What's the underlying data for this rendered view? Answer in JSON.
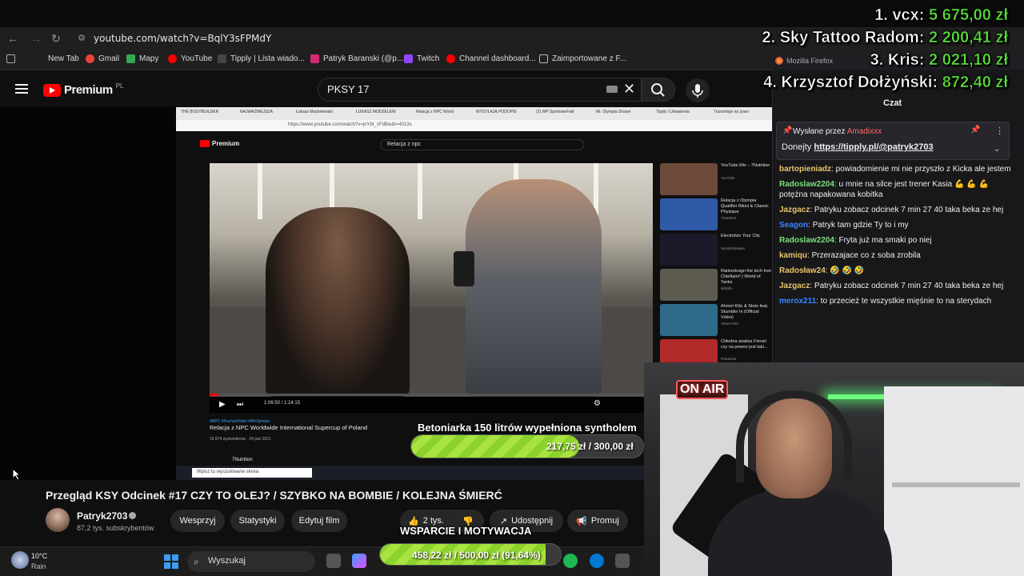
{
  "browser": {
    "url": "youtube.com/watch?v=BqlY3sFPMdY",
    "bookmarks": [
      "New Tab",
      "Gmail",
      "Mapy",
      "YouTube",
      "Tipply | Lista wiado...",
      "Patryk Baranski (@p...",
      "Twitch",
      "Channel dashboard...",
      "Zaimportowane z F..."
    ]
  },
  "youtube": {
    "logo": "Premium",
    "country": "PL",
    "search_query": "PKSY 17",
    "video_title": "Przegląd KSY Odcinek #17 CZY TO OLEJ? / SZYBKO NA BOMBIE / KOLEJNA ŚMIERĆ",
    "channel_name": "Patryk2703",
    "subscribers": "87,2 tys. subskrybentów",
    "actions": {
      "support": "Wesprzyj",
      "stats": "Statystyki",
      "edit": "Edytuj film",
      "likes": "2 tys.",
      "share": "Udostępnij",
      "promote": "Promuj"
    }
  },
  "inner_screen": {
    "tabs": [
      "THE BODYBUILDER",
      "NAJWAŻNIEJSZA",
      "Łukasz Modzelewski",
      "ŁUKASZ MODZELEW",
      "Relacja z NPC World",
      "WYSYŁAJĄ PODOPIE",
      "(2) WP SportoweFakt",
      "Mr. Olympia Shawn",
      "Tipply | Ustawienia",
      "Transmisje na żywo"
    ],
    "url": "https://www.youtube.com/watch?v=jnYbt_sFdBw&t=4013s",
    "logo": "Premium",
    "search_query": "Relacja z npc",
    "video_time": "1:06:50 / 1:24:15",
    "tags": "#NPC #PucharPolski #MrOlympia",
    "video_title": "Relacja z NPC Worldwide International Supercup of Poland",
    "views": "15 874 wyświetlenia",
    "date": "24 paź 2021",
    "channel": "7Nutrition",
    "taskbar_search": "Wpisz tu wyszukiwane słowa",
    "suggestions": [
      {
        "title": "YouTube Mix – 7Nutrition",
        "meta": "YouTube",
        "color": "#6b4a3a"
      },
      {
        "title": "Relacja z Olympia Qualifier Bikini & Classic Physique",
        "meta": "7Nutrition",
        "color": "#2f5aa8"
      },
      {
        "title": "Electrolize Your City",
        "meta": "Symphobreaks",
        "color": "#1a1a2a"
      },
      {
        "title": "Rankedvagn the tech tree Chieftain!! | World of Tanks",
        "meta": "skill4ltu",
        "color": "#5d5a50"
      },
      {
        "title": "Ahmet Kilic & Stoto feat. Stumblin In (Official Video)",
        "meta": "Ahmet Kilic",
        "color": "#2e6a8a"
      },
      {
        "title": "Chłodna analiza Ferrari czy na pewno jest taki...",
        "meta": "Poważnie",
        "color": "#b02a2a"
      }
    ]
  },
  "goals": {
    "goal1_title": "Betoniarka 150 litrów wypełniona syntholem",
    "goal1_amount": "217,75 zł / 300,00 zł",
    "goal1_progress": 0.7258,
    "goal2_title": "WSPARCIE I MOTYWACJA",
    "goal2_amount": "458,22 zł / 500,00 zł (91,64%)",
    "goal2_progress": 0.9164
  },
  "leaderboard": [
    {
      "rank": "1.",
      "name": "vcx:",
      "amount": "5 675,00 zł"
    },
    {
      "rank": "2.",
      "name": "Sky Tattoo Radom:",
      "amount": "2 200,41 zł"
    },
    {
      "rank": "3.",
      "name": "Kris:",
      "amount": "2 021,10 zł"
    },
    {
      "rank": "4.",
      "name": "Krzysztof Dołżyński:",
      "amount": "872,40 zł"
    }
  ],
  "chat": {
    "window_title": "Mozilla Firefox",
    "header": "Czat",
    "pinned_by_label": "Wysłane przez",
    "pinned_by_user": "Amadixxx",
    "pinned_message_prefix": "Donejty",
    "pinned_link": "https://tipply.pl/@patryk2703",
    "messages": [
      {
        "user": "bartopieniadz",
        "color": "#e8c46a",
        "text": "powiadomienie mi nie przyszło z Kicka ale jestem"
      },
      {
        "user": "Radoslaw2204",
        "color": "#7be07b",
        "text": "u mnie na silce jest trener Kasia 💪 💪 💪 potężna napakowana kobitka"
      },
      {
        "user": "Jazgacz",
        "color": "#e8c46a",
        "text": "Patryku zobacz odcinek 7 min 27 40 taka beka ze hej"
      },
      {
        "user": "Seagon",
        "color": "#3a86ff",
        "text": "Patryk tam gdzie Ty to i my"
      },
      {
        "user": "Radoslaw2204",
        "color": "#7be07b",
        "text": "Fryta już ma smaki po niej"
      },
      {
        "user": "kamiqu",
        "color": "#e8c46a",
        "text": "Przerazajace co z soba zrobila"
      },
      {
        "user": "Radosław24",
        "color": "#e8c46a",
        "text": "🤣 🤣 🤣"
      },
      {
        "user": "Jazgacz",
        "color": "#e8c46a",
        "text": "Patryku zobacz odcinek 7 min 27 40 taka beka ze hej"
      },
      {
        "user": "merox211",
        "color": "#3a86ff",
        "text": "to przecież te wszystkie mięśnie to na sterydach"
      }
    ]
  },
  "webcam": {
    "sign": "ON AIR"
  },
  "taskbar": {
    "temperature": "10°C",
    "weather": "Rain",
    "search": "Wyszukaj"
  }
}
